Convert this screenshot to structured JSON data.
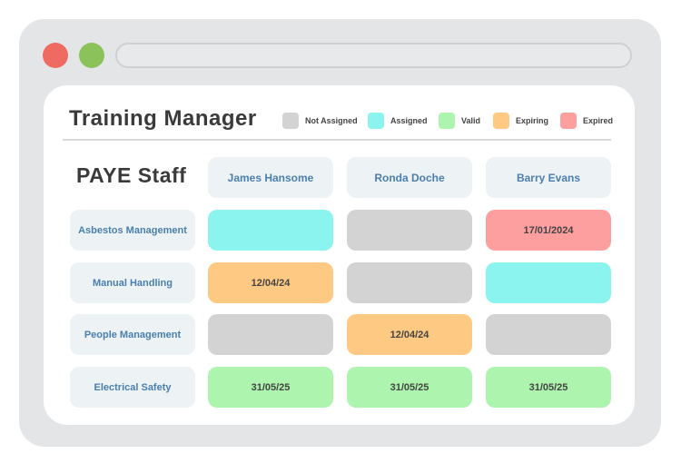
{
  "window": {
    "controls": [
      {
        "name": "close",
        "color": "#ef6b62"
      },
      {
        "name": "maximize",
        "color": "#8bc35a"
      }
    ]
  },
  "app": {
    "title": "Training Manager"
  },
  "legend": [
    {
      "status": "not_assigned",
      "label": "Not Assigned",
      "color": "#d3d3d3"
    },
    {
      "status": "assigned",
      "label": "Assigned",
      "color": "#8cf4ee"
    },
    {
      "status": "valid",
      "label": "Valid",
      "color": "#adf5af"
    },
    {
      "status": "expiring",
      "label": "Expiring",
      "color": "#fec982"
    },
    {
      "status": "expired",
      "label": "Expired",
      "color": "#fd9f9f"
    }
  ],
  "grid": {
    "section_title": "PAYE Staff",
    "staff": [
      "James Hansome",
      "Ronda Doche",
      "Barry Evans"
    ],
    "courses": [
      {
        "name": "Asbestos Management",
        "cells": [
          {
            "status": "assigned",
            "date": ""
          },
          {
            "status": "not_assigned",
            "date": ""
          },
          {
            "status": "expired",
            "date": "17/01/2024"
          }
        ]
      },
      {
        "name": "Manual Handling",
        "cells": [
          {
            "status": "expiring",
            "date": "12/04/24"
          },
          {
            "status": "not_assigned",
            "date": ""
          },
          {
            "status": "assigned",
            "date": ""
          }
        ]
      },
      {
        "name": "People Management",
        "cells": [
          {
            "status": "not_assigned",
            "date": ""
          },
          {
            "status": "expiring",
            "date": "12/04/24"
          },
          {
            "status": "not_assigned",
            "date": ""
          }
        ]
      },
      {
        "name": "Electrical Safety",
        "cells": [
          {
            "status": "valid",
            "date": "31/05/25"
          },
          {
            "status": "valid",
            "date": "31/05/25"
          },
          {
            "status": "valid",
            "date": "31/05/25"
          }
        ]
      }
    ]
  }
}
